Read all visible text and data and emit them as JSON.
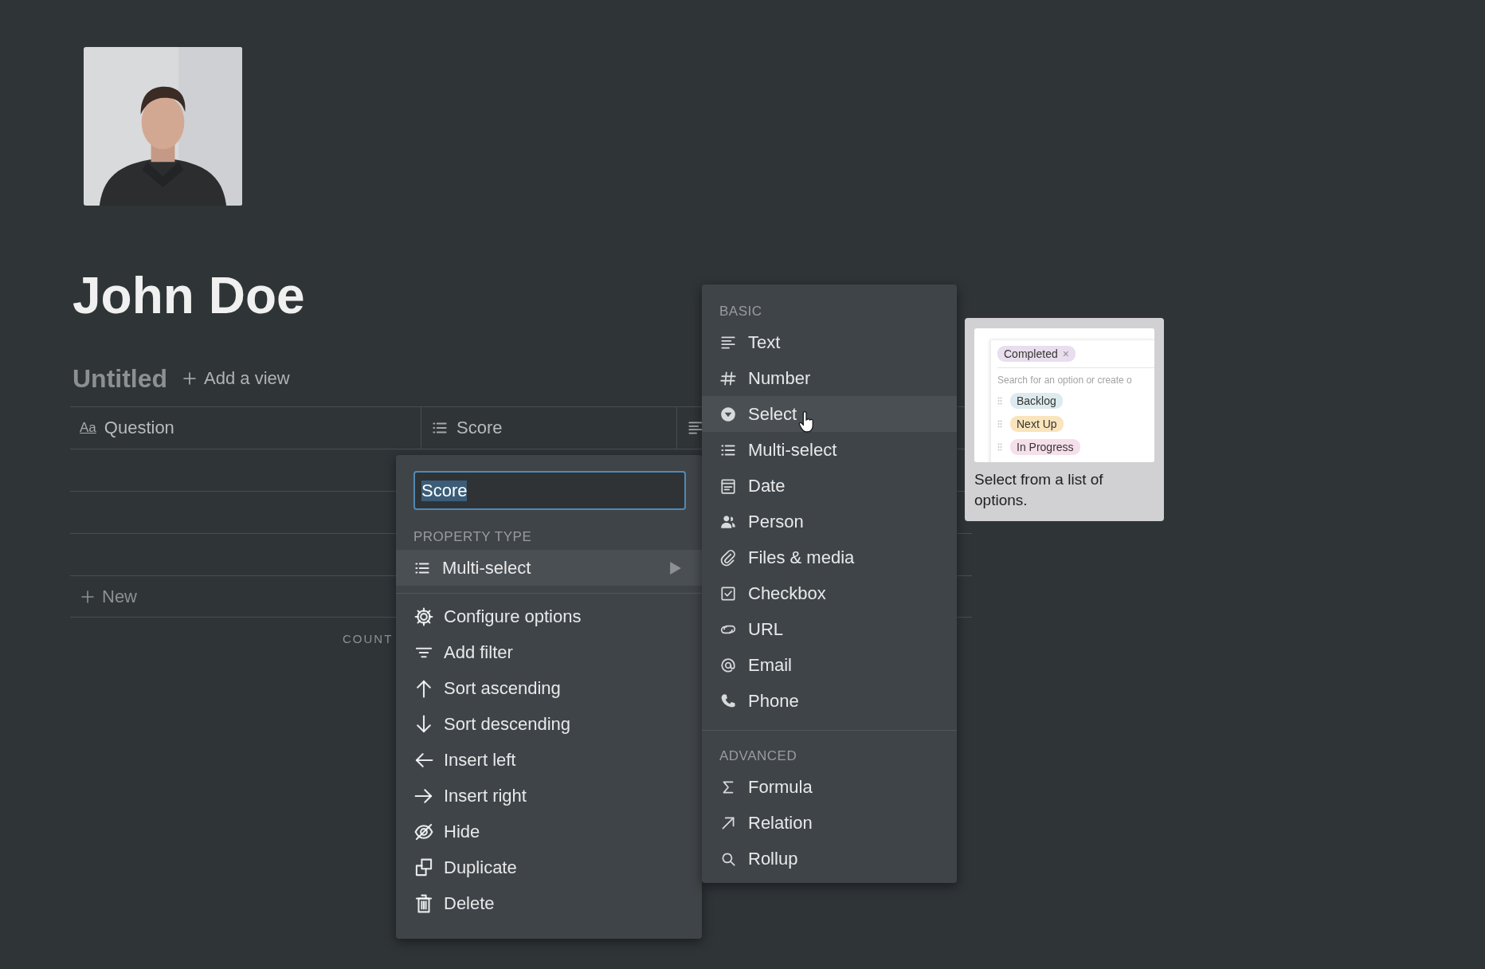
{
  "page": {
    "title": "John Doe"
  },
  "view": {
    "title": "Untitled",
    "add_view": "Add a view"
  },
  "table": {
    "columns": [
      {
        "name": "Question",
        "icon_text": "Aa"
      },
      {
        "name": "Score",
        "kind": "multi"
      },
      {
        "kind": "text"
      }
    ],
    "new_row": "New",
    "footer": "COUNT"
  },
  "property_menu": {
    "name_value": "Score",
    "section": "PROPERTY TYPE",
    "type": {
      "label": "Multi-select",
      "kind": "multi"
    },
    "actions": [
      {
        "label": "Configure options",
        "kind": "gear"
      },
      {
        "label": "Add filter",
        "kind": "filter"
      },
      {
        "label": "Sort ascending",
        "kind": "up"
      },
      {
        "label": "Sort descending",
        "kind": "down"
      },
      {
        "label": "Insert left",
        "kind": "left"
      },
      {
        "label": "Insert right",
        "kind": "right"
      },
      {
        "label": "Hide",
        "kind": "hide"
      },
      {
        "label": "Duplicate",
        "kind": "duplicate"
      },
      {
        "label": "Delete",
        "kind": "delete"
      }
    ]
  },
  "type_menu": {
    "sections": [
      {
        "title": "BASIC",
        "items": [
          {
            "label": "Text",
            "kind": "text",
            "selected": false
          },
          {
            "label": "Number",
            "kind": "number",
            "selected": false
          },
          {
            "label": "Select",
            "kind": "select",
            "selected": true
          },
          {
            "label": "Multi-select",
            "kind": "multi",
            "selected": false
          },
          {
            "label": "Date",
            "kind": "date",
            "selected": false
          },
          {
            "label": "Person",
            "kind": "person",
            "selected": false
          },
          {
            "label": "Files & media",
            "kind": "files",
            "selected": false
          },
          {
            "label": "Checkbox",
            "kind": "checkbox",
            "selected": false
          },
          {
            "label": "URL",
            "kind": "url",
            "selected": false
          },
          {
            "label": "Email",
            "kind": "email",
            "selected": false
          },
          {
            "label": "Phone",
            "kind": "phone",
            "selected": false
          }
        ]
      },
      {
        "title": "ADVANCED",
        "items": [
          {
            "label": "Formula",
            "kind": "formula",
            "selected": false
          },
          {
            "label": "Relation",
            "kind": "relation",
            "selected": false
          },
          {
            "label": "Rollup",
            "kind": "rollup",
            "selected": false
          }
        ]
      }
    ]
  },
  "preview": {
    "chosen": {
      "label": "Completed",
      "remove": "×",
      "color": "#e8deee"
    },
    "search_placeholder": "Search for an option or create o",
    "options": [
      {
        "label": "Backlog",
        "color": "#ddebf1"
      },
      {
        "label": "Next Up",
        "color": "#f9e4bc"
      },
      {
        "label": "In Progress",
        "color": "#f4dfeb"
      }
    ],
    "description": "Select from a list of options."
  }
}
